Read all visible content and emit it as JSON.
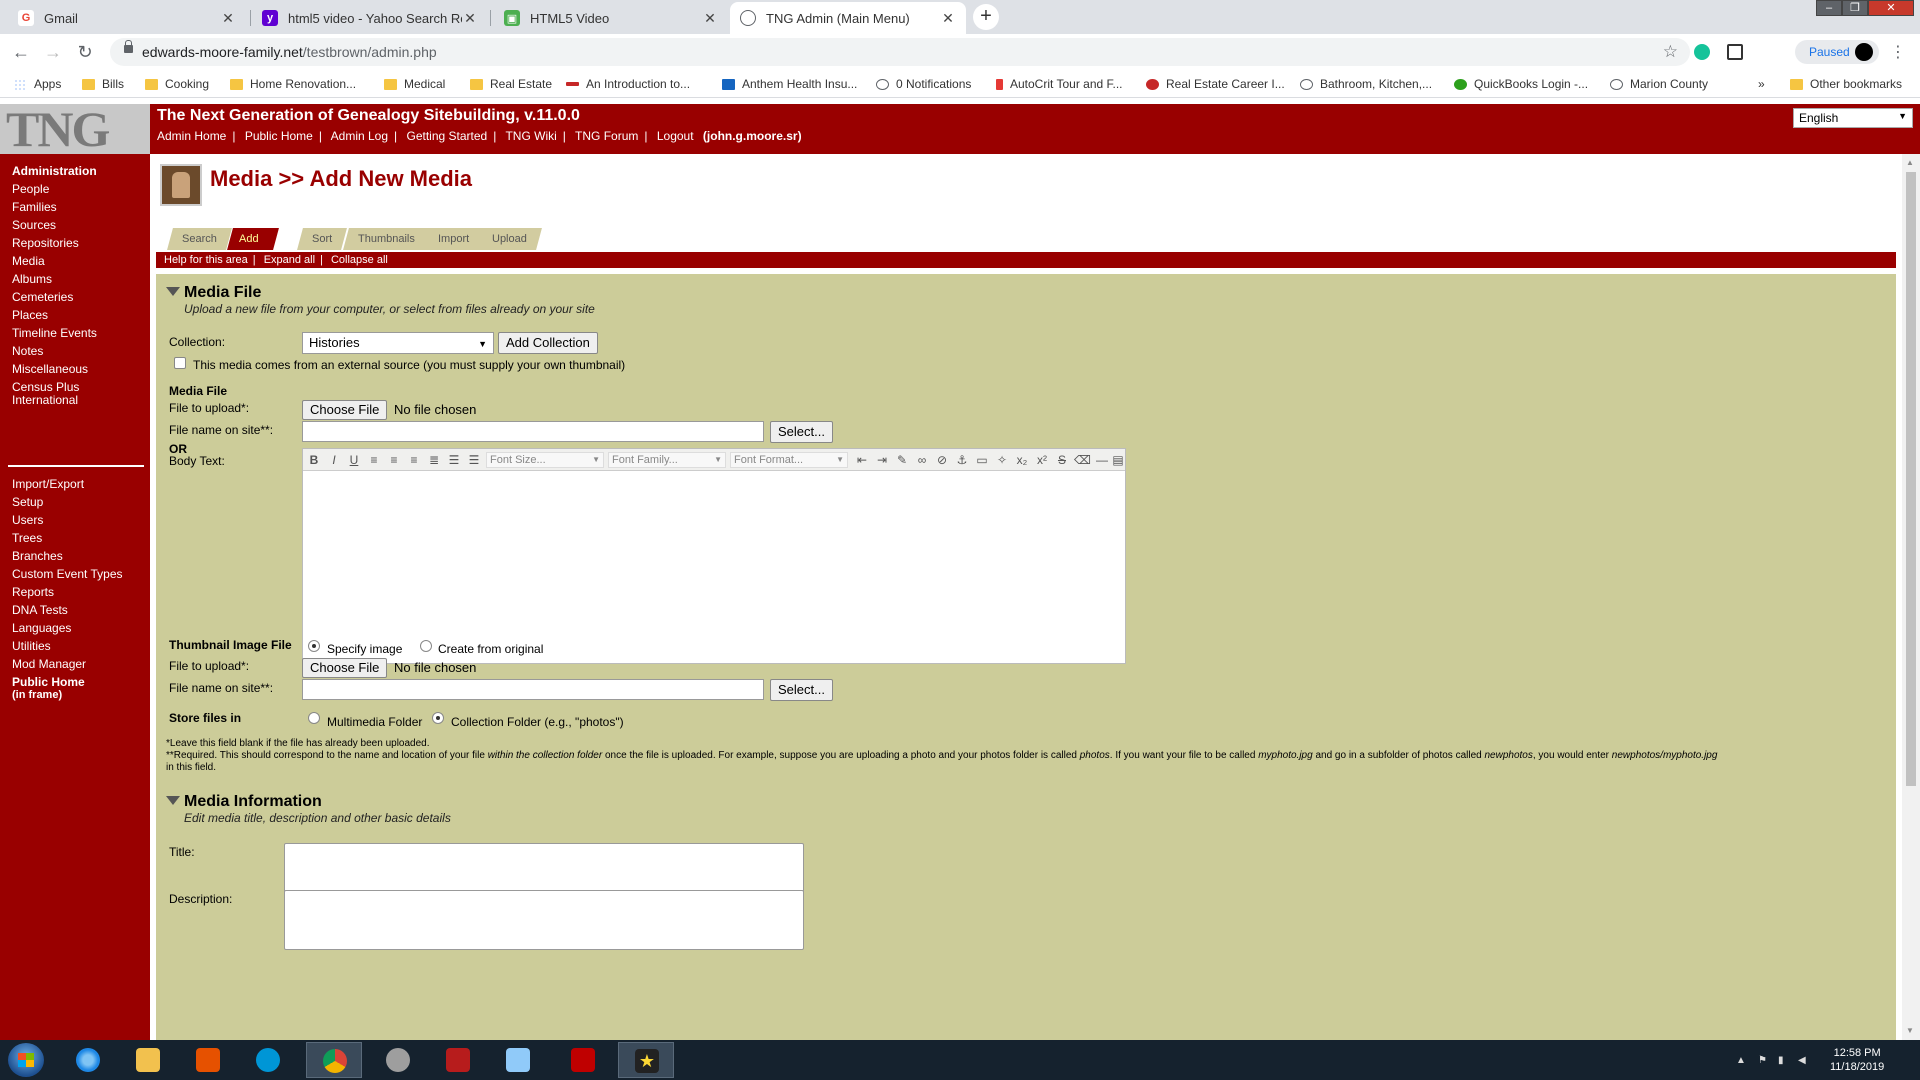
{
  "browser": {
    "tabs": [
      {
        "title": "Gmail",
        "icon": "gmail-icon",
        "color": "#ea4335"
      },
      {
        "title": "html5 video - Yahoo Search Resu",
        "icon": "yahoo-icon",
        "color": "#6001d2"
      },
      {
        "title": "HTML5 Video",
        "icon": "html5-icon",
        "color": "#4caf50"
      },
      {
        "title": "TNG Admin (Main Menu)",
        "icon": "globe-icon",
        "color": "#5f6368"
      }
    ],
    "url_domain": "edwards-moore-family.net",
    "url_path": "/testbrown/admin.php",
    "profile_label": "Paused",
    "bookmarks": [
      "Apps",
      "Bills",
      "Cooking",
      "Home Renovation...",
      "Medical",
      "Real Estate",
      "An Introduction to...",
      "Anthem Health Insu...",
      "0 Notifications",
      "AutoCrit Tour and F...",
      "Real Estate Career I...",
      "Bathroom, Kitchen,...",
      "QuickBooks Login -...",
      "Marion County"
    ],
    "bookmarks_overflow": "»",
    "other_bookmarks": "Other bookmarks"
  },
  "header": {
    "logo": "TNG",
    "site_title": "The Next Generation of Genealogy Sitebuilding, v.11.0.0",
    "links": [
      "Admin Home",
      "Public Home",
      "Admin Log",
      "Getting Started",
      "TNG Wiki",
      "TNG Forum",
      "Logout"
    ],
    "user": "(john.g.moore.sr)",
    "language": "English"
  },
  "sidebar": {
    "group1": [
      "Administration",
      "People",
      "Families",
      "Sources",
      "Repositories",
      "Media",
      "Albums",
      "Cemeteries",
      "Places",
      "Timeline Events",
      "Notes",
      "Miscellaneous",
      "Census Plus",
      "International"
    ],
    "group2": [
      "Import/Export",
      "Setup",
      "Users",
      "Trees",
      "Branches",
      "Custom Event Types",
      "Reports",
      "DNA Tests",
      "Languages",
      "Utilities",
      "Mod Manager",
      "Public Home",
      "(in frame)"
    ]
  },
  "main": {
    "page_title": "Media >> Add New Media",
    "tabs": [
      "Search",
      "Add New",
      "Sort",
      "Thumbnails",
      "Import",
      "Upload"
    ],
    "helpbar": [
      "Help for this area",
      "Expand all",
      "Collapse all"
    ],
    "media_file": {
      "heading": "Media File",
      "subheading": "Upload a new file from your computer, or select from files already on your site",
      "collection_label": "Collection:",
      "collection_value": "Histories",
      "add_collection_label": "Add Collection",
      "external_label": "This media comes from an external source (you must supply your own thumbnail)",
      "media_file_heading": "Media File",
      "file_upload_label": "File to upload*:",
      "choose_file_label": "Choose File",
      "no_file_text": "No file chosen",
      "file_name_label": "File name on site**:",
      "select_label": "Select...",
      "or_label": "OR",
      "body_text_label": "Body Text:",
      "editor_font_size": "Font Size...",
      "editor_font_family": "Font Family...",
      "editor_font_format": "Font Format...",
      "thumbnail_heading": "Thumbnail Image File",
      "specify_image": "Specify image",
      "create_from_original": "Create from original",
      "store_files_label": "Store files in",
      "multimedia_folder": "Multimedia Folder",
      "collection_folder": "Collection Folder (e.g., \"photos\")",
      "note1": "*Leave this field blank if the file has already been uploaded.",
      "note2a": "**Required. This should correspond to the name and location of your file ",
      "note2b": "within the collection folder",
      "note2c": " once the file is uploaded. For example, suppose you are uploading a photo and your photos folder is called ",
      "note2d": "photos",
      "note2e": ". If you want your file to be called ",
      "note2f": "myphoto.jpg",
      "note2g": " and go in a subfolder of photos called ",
      "note2h": "newphotos",
      "note2i": ", you would enter ",
      "note2j": "newphotos/myphoto.jpg",
      "note3": "in this field."
    },
    "media_info": {
      "heading": "Media Information",
      "subheading": "Edit media title, description and other basic details",
      "title_label": "Title:",
      "description_label": "Description:"
    }
  },
  "taskbar": {
    "time": "12:58 PM",
    "date": "11/18/2019"
  },
  "colors": {
    "tng_red": "#990000",
    "section_bg": "#cccc99",
    "active_tab_text": "#ffff99"
  }
}
